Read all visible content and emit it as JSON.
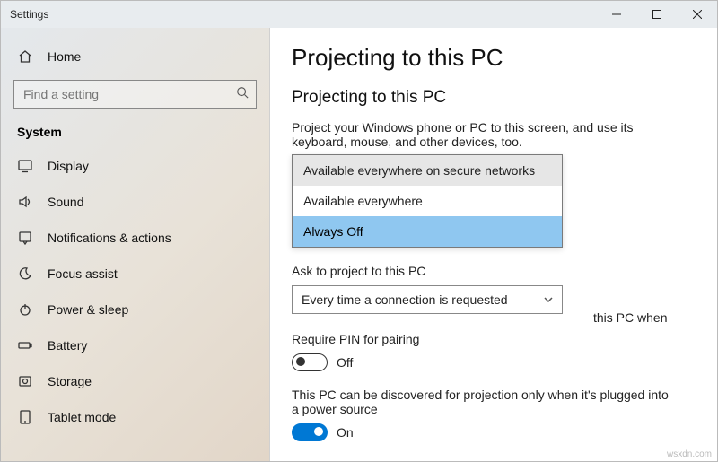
{
  "window": {
    "title": "Settings"
  },
  "sidebar": {
    "home": "Home",
    "search_placeholder": "Find a setting",
    "section": "System",
    "items": [
      {
        "label": "Display"
      },
      {
        "label": "Sound"
      },
      {
        "label": "Notifications & actions"
      },
      {
        "label": "Focus assist"
      },
      {
        "label": "Power & sleep"
      },
      {
        "label": "Battery"
      },
      {
        "label": "Storage"
      },
      {
        "label": "Tablet mode"
      }
    ]
  },
  "page": {
    "title": "Projecting to this PC",
    "subtitle": "Projecting to this PC",
    "intro": "Project your Windows phone or PC to this screen, and use its keyboard, mouse, and other devices, too.",
    "behind_fragment": "this PC when",
    "dropdown_options": [
      "Available everywhere on secure networks",
      "Available everywhere",
      "Always Off"
    ],
    "ask_label": "Ask to project to this PC",
    "ask_value": "Every time a connection is requested",
    "pin_label": "Require PIN for pairing",
    "pin_toggle_text": "Off",
    "discover_label": "This PC can be discovered for projection only when it's plugged into a power source",
    "discover_toggle_text": "On"
  },
  "watermark": "wsxdn.com"
}
